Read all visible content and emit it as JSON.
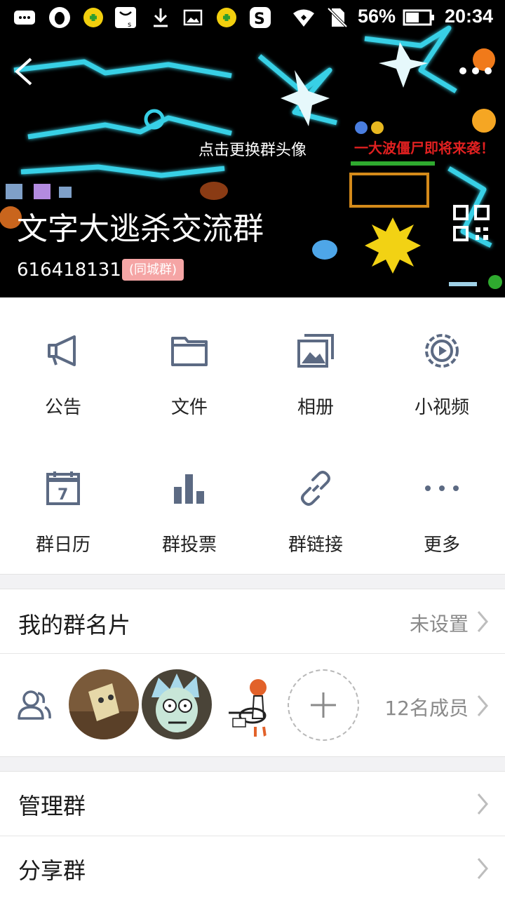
{
  "status_bar": {
    "battery": "56%",
    "time": "20:34",
    "icons": [
      "message-icon",
      "qq-icon",
      "plus-app-icon",
      "store-icon",
      "download-icon",
      "gallery-icon",
      "plus-app-icon",
      "sogou-icon",
      "wifi-icon",
      "no-sim-icon",
      "battery-icon"
    ]
  },
  "header": {
    "change_avatar": "点击更换群头像",
    "group_name": "文字大逃杀交流群",
    "group_id": "616418131",
    "badge": "(同城群)",
    "icons": [
      "back-arrow-icon",
      "more-dots-icon",
      "qr-code-icon"
    ]
  },
  "grid": {
    "items": [
      {
        "label": "公告",
        "icon": "megaphone-icon"
      },
      {
        "label": "文件",
        "icon": "folder-icon"
      },
      {
        "label": "相册",
        "icon": "album-icon"
      },
      {
        "label": "小视频",
        "icon": "video-icon"
      },
      {
        "label": "群日历",
        "icon": "calendar-icon",
        "day": "7"
      },
      {
        "label": "群投票",
        "icon": "bar-chart-icon"
      },
      {
        "label": "群链接",
        "icon": "link-icon"
      },
      {
        "label": "更多",
        "icon": "more-horizontal-icon"
      }
    ]
  },
  "card": {
    "label": "我的群名片",
    "value": "未设置"
  },
  "members": {
    "count": "12名成员",
    "icon": "members-icon"
  },
  "menu": [
    {
      "label": "管理群"
    },
    {
      "label": "分享群"
    }
  ],
  "colors": {
    "icon": "#5c6a83",
    "badge": "#f5a5a5",
    "lightning": "#38d0e6"
  }
}
